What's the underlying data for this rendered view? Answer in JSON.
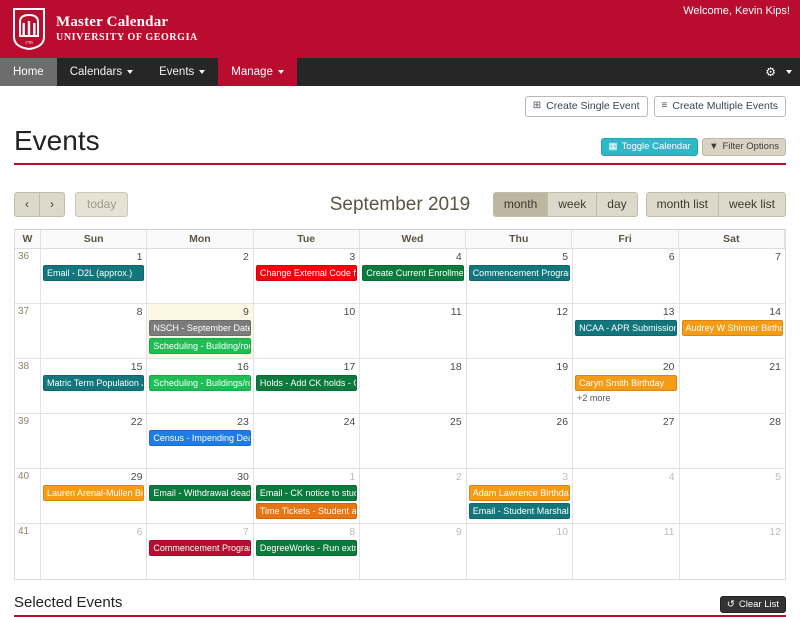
{
  "masthead": {
    "brand_line1": "Master Calendar",
    "brand_line2": "UNIVERSITY OF GEORGIA",
    "welcome": "Welcome, Kevin Kips!",
    "brand_color": "#BA0C2F"
  },
  "nav": {
    "items": [
      {
        "label": "Home",
        "caret": false,
        "state": "active-home"
      },
      {
        "label": "Calendars",
        "caret": true,
        "state": ""
      },
      {
        "label": "Events",
        "caret": true,
        "state": ""
      },
      {
        "label": "Manage",
        "caret": true,
        "state": "active-manage"
      }
    ],
    "gear_icon": "gear-icon",
    "gear_glyph": "⚙"
  },
  "toolbar": {
    "create_single": "Create Single Event",
    "create_single_glyph": "⊞",
    "create_multiple": "Create Multiple Events",
    "create_multiple_glyph": "≡",
    "toggle_calendar": "Toggle Calendar",
    "toggle_calendar_glyph": "▦",
    "filter_options": "Filter Options",
    "filter_options_glyph": "▼",
    "toggle_color": "#2DB9C7",
    "filter_color": "#d8d3c3"
  },
  "page": {
    "title": "Events",
    "rule_color": "#BA0C2F"
  },
  "calendar": {
    "prev_label": "‹",
    "next_label": "›",
    "today_label": "today",
    "title": "September 2019",
    "views": [
      "month",
      "week",
      "day"
    ],
    "selected_view": "month",
    "list_views": [
      "month list",
      "week list"
    ],
    "week_col_header": "W",
    "day_headers": [
      "Sun",
      "Mon",
      "Tue",
      "Wed",
      "Thu",
      "Fri",
      "Sat"
    ],
    "rows": [
      {
        "week": "36",
        "days": [
          {
            "num": "1",
            "other": false,
            "today": false,
            "events": [
              {
                "title": "Email - D2L (approx.)",
                "color": "#12767C"
              }
            ]
          },
          {
            "num": "2",
            "other": false,
            "today": false,
            "events": []
          },
          {
            "num": "3",
            "other": false,
            "today": false,
            "events": [
              {
                "title": "Change External Code for A",
                "color": "#F5000B"
              }
            ]
          },
          {
            "num": "4",
            "other": false,
            "today": false,
            "events": [
              {
                "title": "Create Current Enrollment C",
                "color": "#0C7A3D"
              }
            ]
          },
          {
            "num": "5",
            "other": false,
            "today": false,
            "events": [
              {
                "title": "Commencement Program -",
                "color": "#12767C"
              }
            ]
          },
          {
            "num": "6",
            "other": false,
            "today": false,
            "events": []
          },
          {
            "num": "7",
            "other": false,
            "today": false,
            "events": []
          }
        ]
      },
      {
        "week": "37",
        "days": [
          {
            "num": "8",
            "other": false,
            "today": false,
            "events": []
          },
          {
            "num": "9",
            "other": false,
            "today": true,
            "events": [
              {
                "title": "NSCH - September Dates",
                "color": "#7C7C7C"
              },
              {
                "title": "Scheduling - Building/room",
                "color": "#1DBF55"
              }
            ]
          },
          {
            "num": "10",
            "other": false,
            "today": false,
            "events": []
          },
          {
            "num": "11",
            "other": false,
            "today": false,
            "events": []
          },
          {
            "num": "12",
            "other": false,
            "today": false,
            "events": []
          },
          {
            "num": "13",
            "other": false,
            "today": false,
            "events": [
              {
                "title": "NCAA - APR Submissions D",
                "color": "#12767C"
              }
            ]
          },
          {
            "num": "14",
            "other": false,
            "today": false,
            "events": [
              {
                "title": "Audrey W Shinner Birthday",
                "color": "#F59B16"
              }
            ]
          }
        ]
      },
      {
        "week": "38",
        "days": [
          {
            "num": "15",
            "other": false,
            "today": false,
            "events": [
              {
                "title": "Matric Term Population Job",
                "color": "#12767C"
              }
            ]
          },
          {
            "num": "16",
            "other": false,
            "today": false,
            "events": [
              {
                "title": "Scheduling - Buildings/room",
                "color": "#1DBF55"
              }
            ]
          },
          {
            "num": "17",
            "other": false,
            "today": false,
            "events": [
              {
                "title": "Holds - Add CK holds - Octo",
                "color": "#0C7A3D"
              }
            ]
          },
          {
            "num": "18",
            "other": false,
            "today": false,
            "events": []
          },
          {
            "num": "19",
            "other": false,
            "today": false,
            "events": []
          },
          {
            "num": "20",
            "other": false,
            "today": false,
            "events": [
              {
                "title": "Caryn Smith Birthday",
                "color": "#F59B16"
              }
            ],
            "more": "+2 more"
          },
          {
            "num": "21",
            "other": false,
            "today": false,
            "events": []
          }
        ]
      },
      {
        "week": "39",
        "days": [
          {
            "num": "22",
            "other": false,
            "today": false,
            "events": []
          },
          {
            "num": "23",
            "other": false,
            "today": false,
            "events": [
              {
                "title": "Census - Impending Deadlin",
                "color": "#1E7BE8"
              }
            ]
          },
          {
            "num": "24",
            "other": false,
            "today": false,
            "events": []
          },
          {
            "num": "25",
            "other": false,
            "today": false,
            "events": []
          },
          {
            "num": "26",
            "other": false,
            "today": false,
            "events": []
          },
          {
            "num": "27",
            "other": false,
            "today": false,
            "events": []
          },
          {
            "num": "28",
            "other": false,
            "today": false,
            "events": []
          }
        ]
      },
      {
        "week": "40",
        "days": [
          {
            "num": "29",
            "other": false,
            "today": false,
            "events": [
              {
                "title": "Lauren Arenal-Mullen Birthd",
                "color": "#F59B16"
              }
            ]
          },
          {
            "num": "30",
            "other": false,
            "today": false,
            "events": [
              {
                "title": "Email - Withdrawal deadline",
                "color": "#0C7A3D"
              }
            ]
          },
          {
            "num": "1",
            "other": true,
            "today": false,
            "events": [
              {
                "title": "Email - CK notice to student",
                "color": "#0C7A3D"
              },
              {
                "title": "Time Tickets - Student athle",
                "color": "#E87511"
              }
            ]
          },
          {
            "num": "2",
            "other": true,
            "today": false,
            "events": []
          },
          {
            "num": "3",
            "other": true,
            "today": false,
            "events": [
              {
                "title": "Adam Lawrence Birthday",
                "color": "#F59B16"
              },
              {
                "title": "Email - Student Marshal Sol",
                "color": "#12767C"
              }
            ]
          },
          {
            "num": "4",
            "other": true,
            "today": false,
            "events": []
          },
          {
            "num": "5",
            "other": true,
            "today": false,
            "events": []
          }
        ]
      },
      {
        "week": "41",
        "days": [
          {
            "num": "6",
            "other": true,
            "today": false,
            "events": []
          },
          {
            "num": "7",
            "other": true,
            "today": false,
            "events": [
              {
                "title": "Commencement Program -",
                "color": "#BA0C2F"
              }
            ]
          },
          {
            "num": "8",
            "other": true,
            "today": false,
            "events": [
              {
                "title": "DegreeWorks - Run extract",
                "color": "#0C7A3D"
              }
            ]
          },
          {
            "num": "9",
            "other": true,
            "today": false,
            "events": []
          },
          {
            "num": "10",
            "other": true,
            "today": false,
            "events": []
          },
          {
            "num": "11",
            "other": true,
            "today": false,
            "events": []
          },
          {
            "num": "12",
            "other": true,
            "today": false,
            "events": []
          }
        ]
      }
    ]
  },
  "selected_events": {
    "title": "Selected Events",
    "clear_label": "Clear List",
    "clear_glyph": "↺"
  }
}
